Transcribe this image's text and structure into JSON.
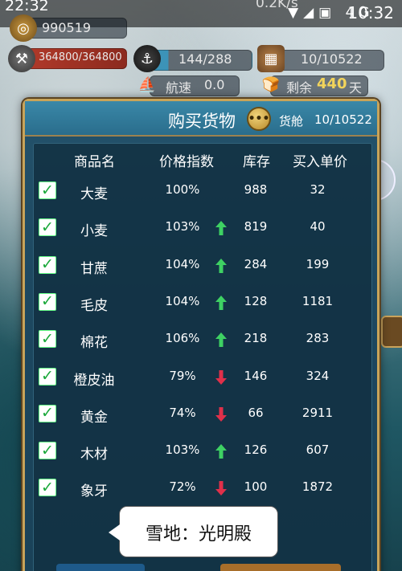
{
  "status_bar": {
    "left_time": "22:32",
    "speed": "0.2K/s",
    "icons": "▼◢▣ 4G",
    "time": "10:32"
  },
  "hud": {
    "gold": "990519",
    "hp": "364800/364800",
    "crew": "144/288",
    "cargo": "10/10522",
    "speed_label": "航速",
    "speed_value": "0.0",
    "remaining_label": "剩余",
    "remaining_days": "440",
    "days_unit": "天"
  },
  "dialog": {
    "title": "购买货物",
    "coin_icon_text": "•••",
    "hold_label": "货舱",
    "hold_value": "10/10522",
    "columns": [
      "商品名",
      "价格指数",
      "库存",
      "买入单价"
    ],
    "rows": [
      {
        "name": "大麦",
        "index": "100%",
        "trend": "none",
        "stock": "988",
        "price": "32"
      },
      {
        "name": "小麦",
        "index": "103%",
        "trend": "up",
        "stock": "819",
        "price": "40"
      },
      {
        "name": "甘蔗",
        "index": "104%",
        "trend": "up",
        "stock": "284",
        "price": "199"
      },
      {
        "name": "毛皮",
        "index": "104%",
        "trend": "up",
        "stock": "128",
        "price": "1181"
      },
      {
        "name": "棉花",
        "index": "106%",
        "trend": "up",
        "stock": "218",
        "price": "283"
      },
      {
        "name": "橙皮油",
        "index": "79%",
        "trend": "down",
        "stock": "146",
        "price": "324"
      },
      {
        "name": "黄金",
        "index": "74%",
        "trend": "down",
        "stock": "66",
        "price": "2911"
      },
      {
        "name": "木材",
        "index": "103%",
        "trend": "up",
        "stock": "126",
        "price": "607"
      },
      {
        "name": "象牙",
        "index": "72%",
        "trend": "down",
        "stock": "100",
        "price": "1872"
      }
    ]
  },
  "tooltip": {
    "text": "雪地：光明殿"
  },
  "colors": {
    "accent_gold": "#c8a45a",
    "trend_up": "#3ed163",
    "trend_down": "#e0304a",
    "check_green": "#1aa83a"
  },
  "icons": [
    "gold-coin-icon",
    "hammer-icon",
    "crew-icon",
    "cargo-crate-icon",
    "sail-icon",
    "food-icon",
    "chat-coin-icon",
    "cube-icon",
    "chest-icon",
    "checkbox-icon",
    "arrow-up-icon",
    "arrow-down-icon"
  ]
}
